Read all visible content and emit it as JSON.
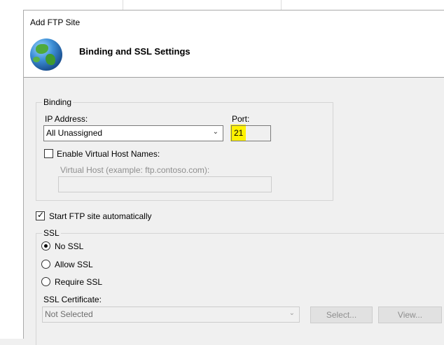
{
  "window": {
    "title": "Add FTP Site"
  },
  "page": {
    "heading": "Binding and SSL Settings",
    "icon": "globe-icon"
  },
  "binding": {
    "group_label": "Binding",
    "ip_label": "IP Address:",
    "ip_value": "All Unassigned",
    "port_label": "Port:",
    "port_value": "21",
    "virtual_host_checkbox_label": "Enable Virtual Host Names:",
    "virtual_host_checked": false,
    "virtual_host_label": "Virtual Host (example: ftp.contoso.com):",
    "virtual_host_value": ""
  },
  "start_automatically": {
    "label": "Start FTP site automatically",
    "checked": true
  },
  "ssl": {
    "group_label": "SSL",
    "options": [
      {
        "label": "No SSL",
        "selected": true
      },
      {
        "label": "Allow SSL",
        "selected": false
      },
      {
        "label": "Require SSL",
        "selected": false
      }
    ],
    "certificate_label": "SSL Certificate:",
    "certificate_value": "Not Selected",
    "select_button": "Select...",
    "view_button": "View..."
  },
  "colors": {
    "highlight": "#fff200",
    "disabled_text": "#8e8e8e"
  }
}
